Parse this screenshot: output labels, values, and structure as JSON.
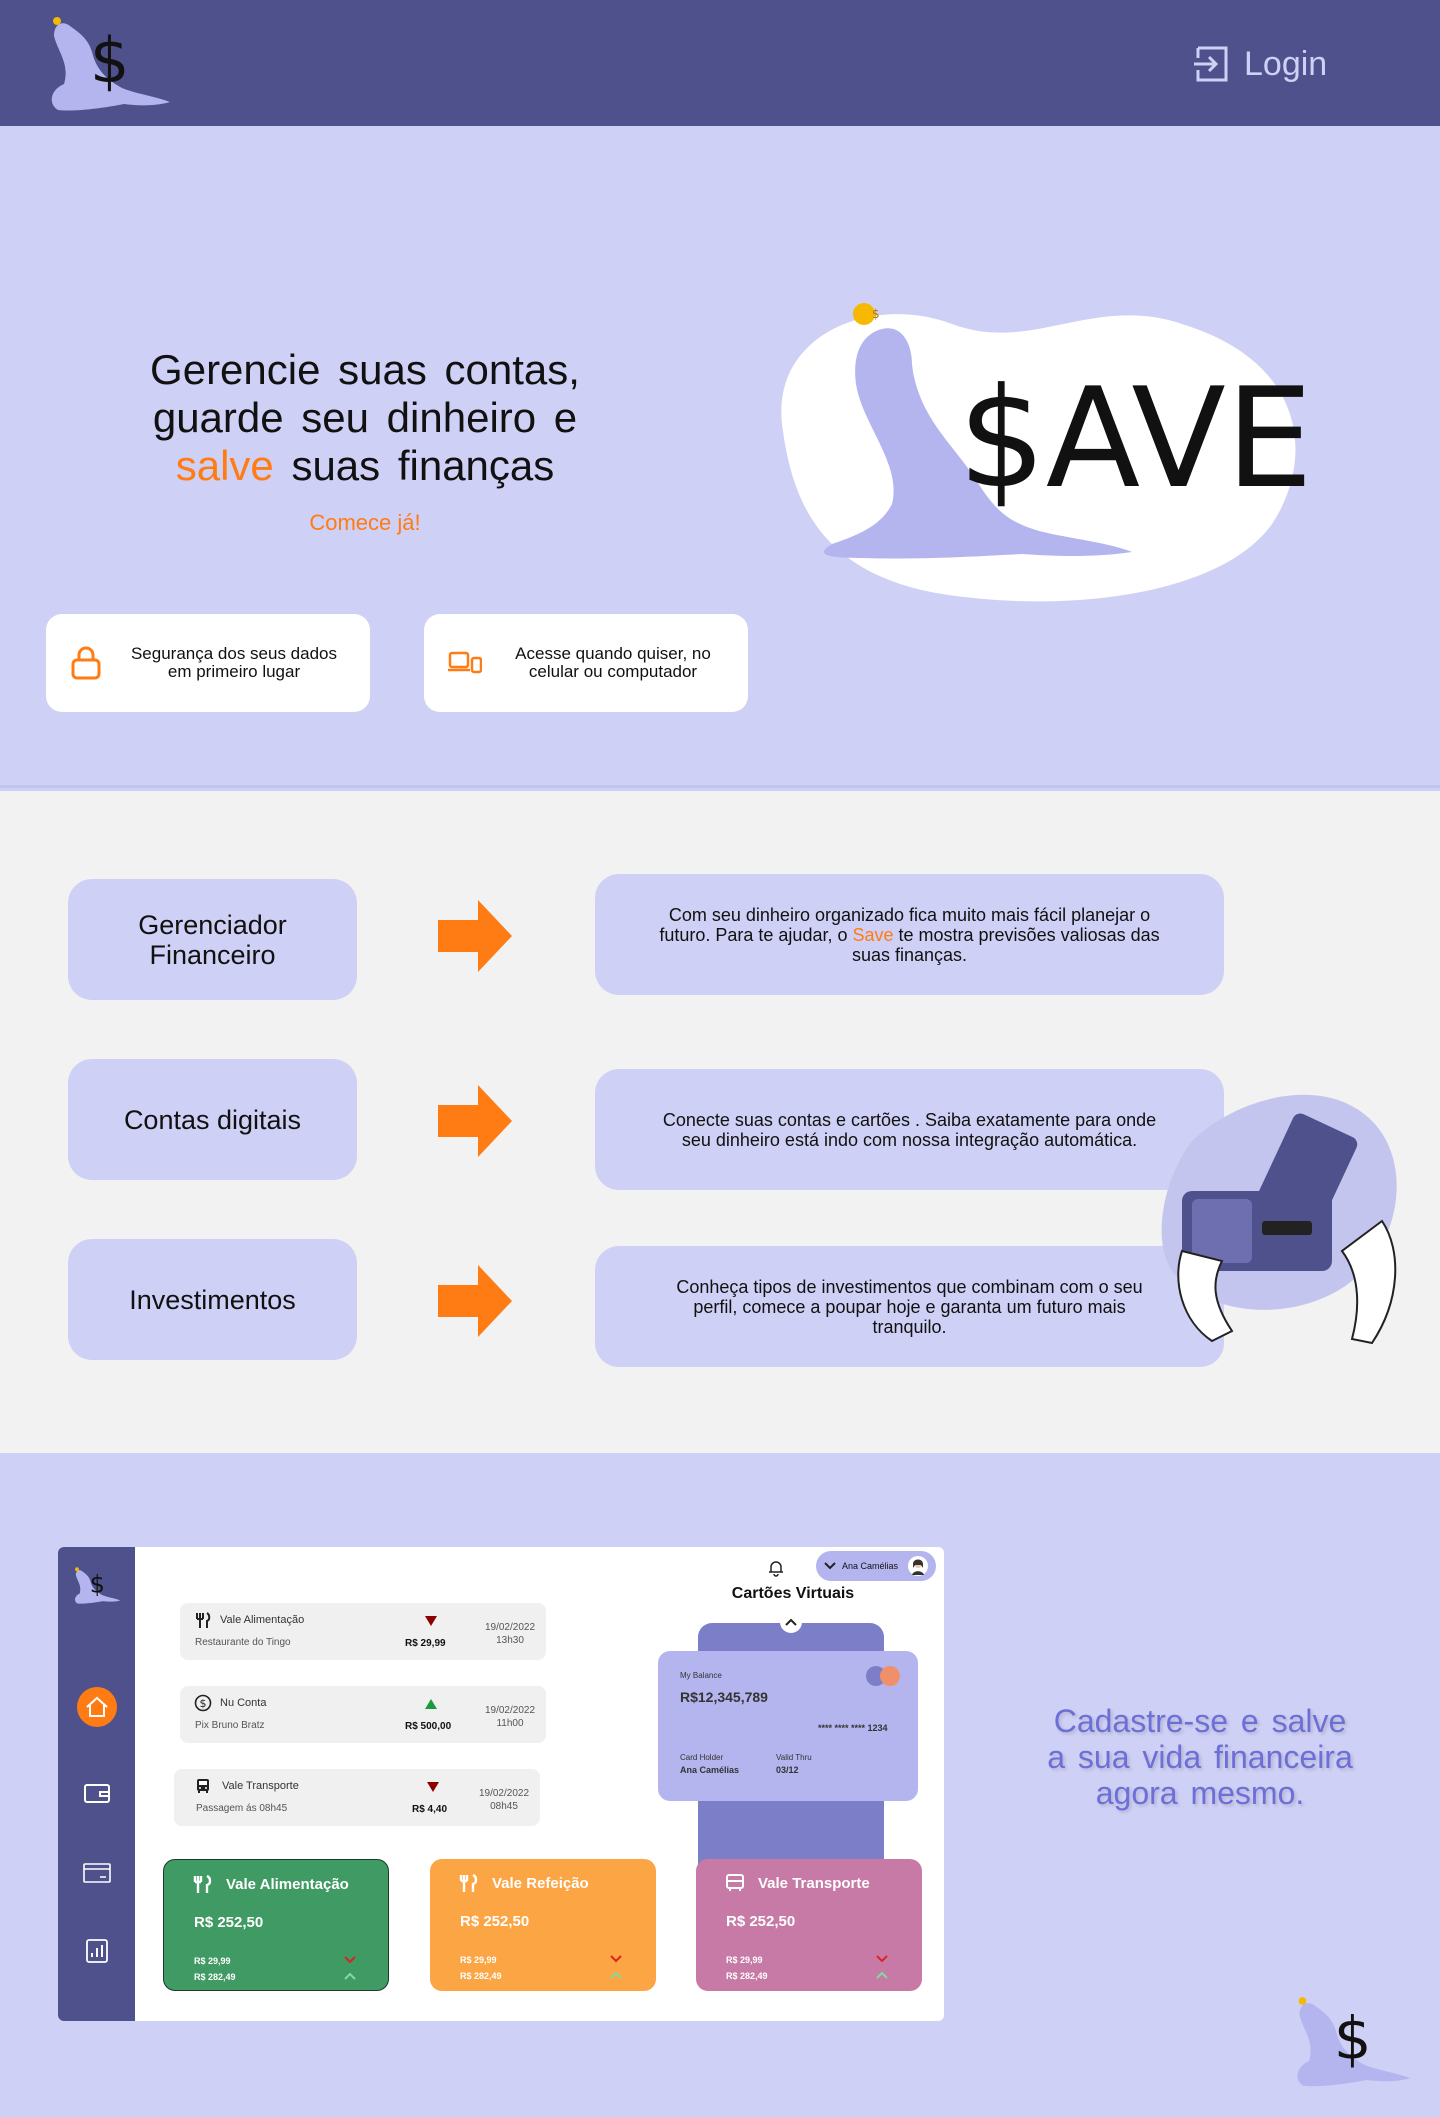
{
  "header": {
    "login_label": "Login"
  },
  "hero": {
    "title_line1": "Gerencie suas contas,",
    "title_line2": "guarde seu dinheiro e",
    "title_accent": "salve",
    "title_rest": " suas finanças",
    "cta": "Comece já!",
    "brand": "$AVE",
    "features": [
      {
        "label": "Segurança dos seus dados em primeiro lugar",
        "icon": "lock-icon"
      },
      {
        "label": "Acesse quando quiser, no celular ou computador",
        "icon": "devices-icon"
      }
    ]
  },
  "features": {
    "items": [
      {
        "title": "Gerenciador Financeiro",
        "desc_before": "Com seu dinheiro organizado fica muito mais fácil planejar o futuro. Para te ajudar, o ",
        "desc_accent": "Save",
        "desc_after": " te mostra previsões valiosas das suas finanças."
      },
      {
        "title": "Contas digitais",
        "desc_before": "Conecte suas contas e cartões . Saiba exatamente para onde seu dinheiro está indo com nossa integração automática.",
        "desc_accent": "",
        "desc_after": ""
      },
      {
        "title": "Investimentos",
        "desc_before": "Conheça tipos de investimentos que combinam com o seu perfil, comece a poupar hoje e garanta um futuro mais tranquilo.",
        "desc_accent": "",
        "desc_after": ""
      }
    ]
  },
  "app": {
    "user": "Ana Camélias",
    "transactions": [
      {
        "name": "Vale Alimentação",
        "sub": "Restaurante do Tingo",
        "amount": "R$ 29,99",
        "date": "19/02/2022",
        "time": "13h30",
        "direction": "down"
      },
      {
        "name": "Nu Conta",
        "sub": "Pix Bruno Bratz",
        "amount": "R$ 500,00",
        "date": "19/02/2022",
        "time": "11h00",
        "direction": "up"
      },
      {
        "name": "Vale Transporte",
        "sub": "Passagem ás 08h45",
        "amount": "R$ 4,40",
        "date": "19/02/2022",
        "time": "08h45",
        "direction": "down"
      }
    ],
    "virtual_cards": {
      "title": "Cartões Virtuais",
      "balance_label": "My Balance",
      "balance": "R$12,345,789",
      "number": "**** **** **** 1234",
      "holder_label": "Card Holder",
      "holder": "Ana Camélias",
      "valid_label": "Valid Thru",
      "valid": "03/12"
    },
    "benefits": [
      {
        "name": "Vale Alimentação",
        "value": "R$ 252,50",
        "line1": "R$ 29,99",
        "line2": "R$ 282,49",
        "color": "#3f9a63"
      },
      {
        "name": "Vale Refeição",
        "value": "R$ 252,50",
        "line1": "R$ 29,99",
        "line2": "R$ 282,49",
        "color": "#fba544"
      },
      {
        "name": "Vale Transporte",
        "value": "R$ 252,50",
        "line1": "R$ 29,99",
        "line2": "R$ 282,49",
        "color": "#c77aa6"
      }
    ]
  },
  "signup": "Cadastre-se e salve a sua vida financeira agora mesmo.",
  "colors": {
    "primary": "#4f518c",
    "lavender": "#cfd0f5",
    "accent": "#ff7b13"
  }
}
